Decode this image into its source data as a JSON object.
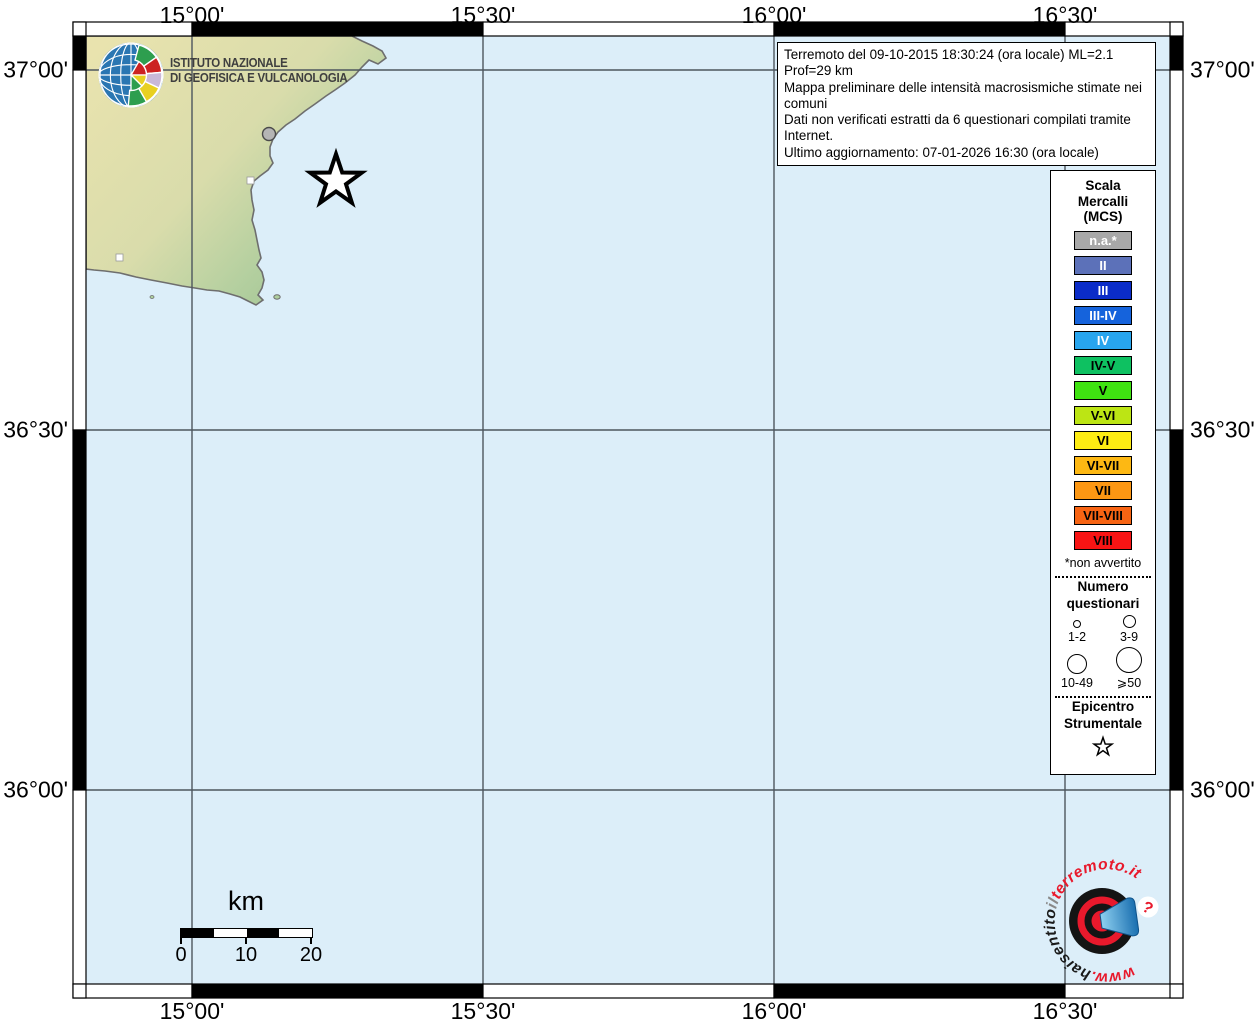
{
  "axes": {
    "top": [
      "15°00'",
      "15°30'",
      "16°00'",
      "16°30'"
    ],
    "bottom": [
      "15°00'",
      "15°30'",
      "16°00'",
      "16°30'"
    ],
    "left": [
      "37°00'",
      "36°30'",
      "36°00'"
    ],
    "right": [
      "37°00'",
      "36°30'",
      "36°00'"
    ]
  },
  "info_box": {
    "lines": [
      "Terremoto del 09-10-2015 18:30:24 (ora locale) ML=2.1 Prof=29 km",
      "Mappa preliminare delle intensità macrosismiche stimate nei comuni",
      "Dati non verificati estratti da 6 questionari compilati tramite Internet.",
      "Ultimo aggiornamento: 07-01-2026 16:30 (ora locale)"
    ]
  },
  "ingv_logo": {
    "name_line1": "ISTITUTO NAZIONALE",
    "name_line2": "DI GEOFISICA E VULCANOLOGIA"
  },
  "legend": {
    "title_lines": [
      "Scala",
      "Mercalli",
      "(MCS)"
    ],
    "items": [
      {
        "label": "n.a.*",
        "color": "#a8a8a8",
        "text_color": "#ffffff"
      },
      {
        "label": "II",
        "color": "#5c71b9",
        "text_color": "#ffffff"
      },
      {
        "label": "III",
        "color": "#0b2cc8",
        "text_color": "#ffffff"
      },
      {
        "label": "III-IV",
        "color": "#1563dc",
        "text_color": "#ffffff"
      },
      {
        "label": "IV",
        "color": "#28a5ee",
        "text_color": "#ffffff"
      },
      {
        "label": "IV-V",
        "color": "#0ec161",
        "text_color": "#000000"
      },
      {
        "label": "V",
        "color": "#3fe311",
        "text_color": "#000000"
      },
      {
        "label": "V-VI",
        "color": "#bce514",
        "text_color": "#000000"
      },
      {
        "label": "VI",
        "color": "#fdec13",
        "text_color": "#000000"
      },
      {
        "label": "VI-VII",
        "color": "#fdb813",
        "text_color": "#000000"
      },
      {
        "label": "VII",
        "color": "#fc9713",
        "text_color": "#000000"
      },
      {
        "label": "VII-VIII",
        "color": "#f76413",
        "text_color": "#000000"
      },
      {
        "label": "VIII",
        "color": "#f81414",
        "text_color": "#000000"
      }
    ],
    "footnote": "*non avvertito",
    "questionnaires": {
      "title_lines": [
        "Numero",
        "questionari"
      ],
      "size_labels": [
        "1-2",
        "3-9",
        "10-49",
        "⩾50"
      ]
    },
    "epicenter_title_lines": [
      "Epicentro",
      "Strumentale"
    ]
  },
  "scale_bar": {
    "unit": "km",
    "tick_labels": [
      "0",
      "10",
      "20"
    ]
  },
  "map": {
    "sea_color": "#dceef9",
    "land_interior_color": "#e9e3ae",
    "land_coast_color": "#97bd8c",
    "grid_color": "#4d565e",
    "community_dot_color": "#b5b5b5"
  },
  "site_logo": {
    "url_parts": {
      "www": "www.",
      "hai": "haisentito",
      "il": "il",
      "site": "terremoto.it"
    },
    "question_mark": "?",
    "accent_red": "#e8192c",
    "megaphone_blue": "#2a8fd0"
  }
}
